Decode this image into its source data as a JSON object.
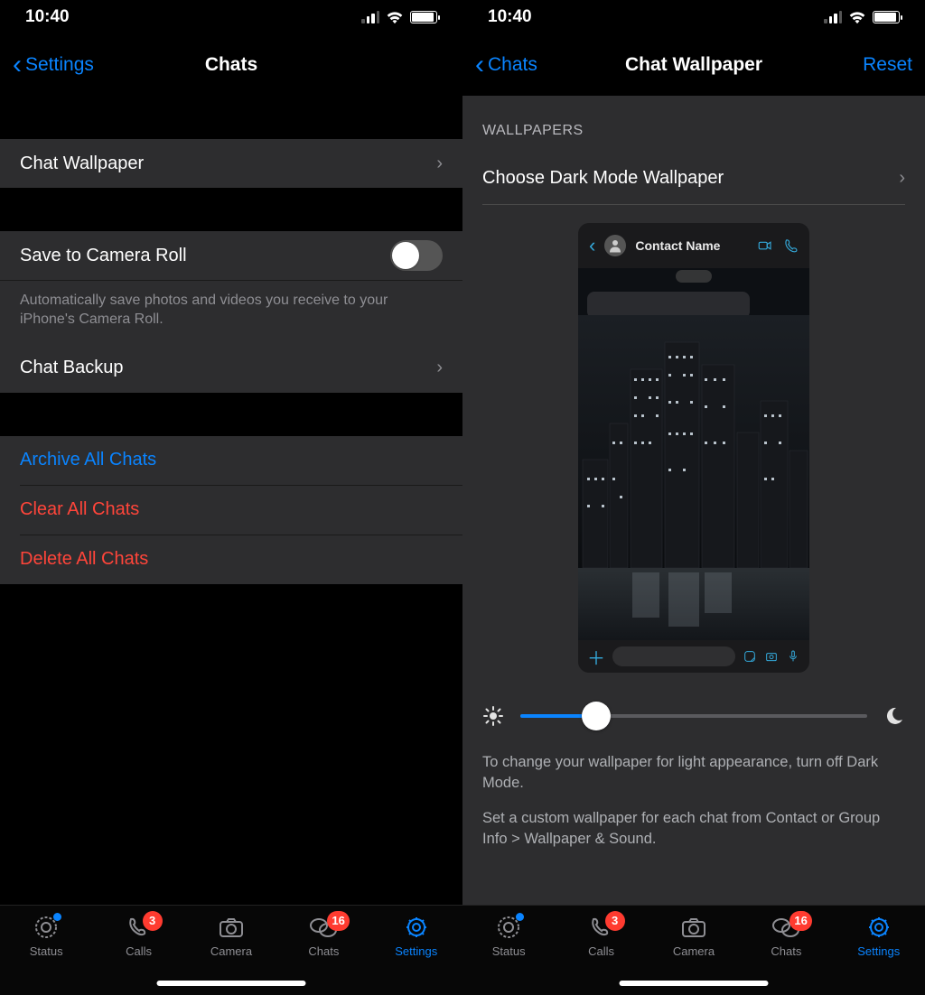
{
  "status": {
    "time": "10:40"
  },
  "left": {
    "nav": {
      "back": "Settings",
      "title": "Chats"
    },
    "items": {
      "chat_wallpaper": "Chat Wallpaper",
      "save_camera": "Save to Camera Roll",
      "save_camera_desc": "Automatically save photos and videos you receive to your iPhone's Camera Roll.",
      "chat_backup": "Chat Backup",
      "archive": "Archive All Chats",
      "clear": "Clear All Chats",
      "delete": "Delete All Chats"
    }
  },
  "right": {
    "nav": {
      "back": "Chats",
      "title": "Chat Wallpaper",
      "action": "Reset"
    },
    "section": "WALLPAPERS",
    "choose": "Choose Dark Mode Wallpaper",
    "preview": {
      "contact": "Contact Name"
    },
    "help1": "To change your wallpaper for light appearance, turn off Dark Mode.",
    "help2": "Set a custom wallpaper for each chat from Contact or Group Info > Wallpaper & Sound."
  },
  "tabs": {
    "status": "Status",
    "calls": "Calls",
    "camera": "Camera",
    "chats": "Chats",
    "settings": "Settings",
    "badge_calls": "3",
    "badge_chats": "16"
  }
}
